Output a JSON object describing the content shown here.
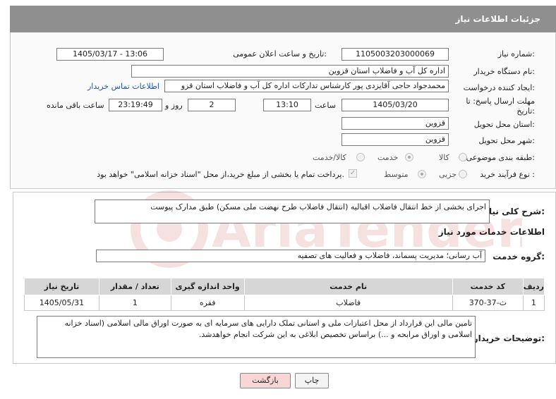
{
  "header": {
    "title": "جزئیات اطلاعات نیاز"
  },
  "form": {
    "need_number": {
      "label": "شماره نیاز:",
      "value": "1105003203000069"
    },
    "announce_datetime": {
      "label": "تاریخ و ساعت اعلان عمومی:",
      "value": "1405/03/17 - 13:06"
    },
    "buyer_org": {
      "label": "نام دستگاه خریدار:",
      "value": "اداره کل آب و فاضلاب استان قزوین"
    },
    "requester": {
      "label": "ایجاد کننده درخواست:",
      "value": "محمدجواد حاجی آقایزدی پور کارشناس تدارکات اداره کل آب و فاضلاب استان قزو",
      "contact_link": "اطلاعات تماس خریدار"
    },
    "deadline": {
      "label": "مهلت ارسال پاسخ: تا تاریخ:",
      "date": "1405/03/20",
      "time_label": "ساعت",
      "time": "13:10",
      "days": "2",
      "days_label": "روز و",
      "remaining": "23:19:49",
      "remaining_label": "ساعت باقی مانده"
    },
    "province": {
      "label": "استان محل تحویل:",
      "value": "قزوین"
    },
    "city": {
      "label": "شهر محل تحویل:",
      "value": "قزوین"
    },
    "category": {
      "label": "طبقه بندی موضوعی:",
      "options": [
        "کالا",
        "خدمت",
        "کالا/خدمت"
      ],
      "selected": "خدمت"
    },
    "process_type": {
      "label": "نوع فرآیند خرید :",
      "options": [
        "جزیی",
        "متوسط"
      ],
      "selected": "متوسط",
      "payment_note": "پرداخت تمام یا بخشی از مبلغ خرید،از محل \"اسناد خزانه اسلامی\" خواهد بود."
    }
  },
  "details": {
    "summary_label": "شرح کلی نیاز:",
    "summary": "اجرای بخشی از خط انتقال فاضلاب اقبالیه (انتقال فاضلاب طرح نهضت ملی مسکن) طبق مدارک پیوست",
    "services_title": "اطلاعات خدمات مورد نیاز",
    "service_group_label": "گروه خدمت:",
    "service_group": "آب رسانی؛ مدیریت پسماند، فاضلاب و فعالیت های تصفیه",
    "table": {
      "headers": [
        "ردیف",
        "کد خدمت",
        "نام خدمت",
        "واحد اندازه گیری",
        "تعداد / مقدار",
        "تاریخ نیاز"
      ],
      "rows": [
        [
          "1",
          "ث-37-370",
          "فاضلاب",
          "فقره",
          "1",
          "1405/05/31"
        ]
      ]
    },
    "buyer_notes_label": "توضیحات خریدار:",
    "buyer_notes": "تامین مالی این قرارداد از محل اعتبارات ملی و استانی تملک دارایی های سرمایه ای به صورت اوراق مالی اسلامی (اسناد خزانه اسلامی و اوراق مرابحه و ...) براساس تخصیص ابلاغی به این شرکت انجام خواهدشد."
  },
  "buttons": {
    "print": "چاپ",
    "back": "بازگشت"
  },
  "watermark": {
    "text": "AriaTender.net",
    "color": "#c0392b"
  }
}
